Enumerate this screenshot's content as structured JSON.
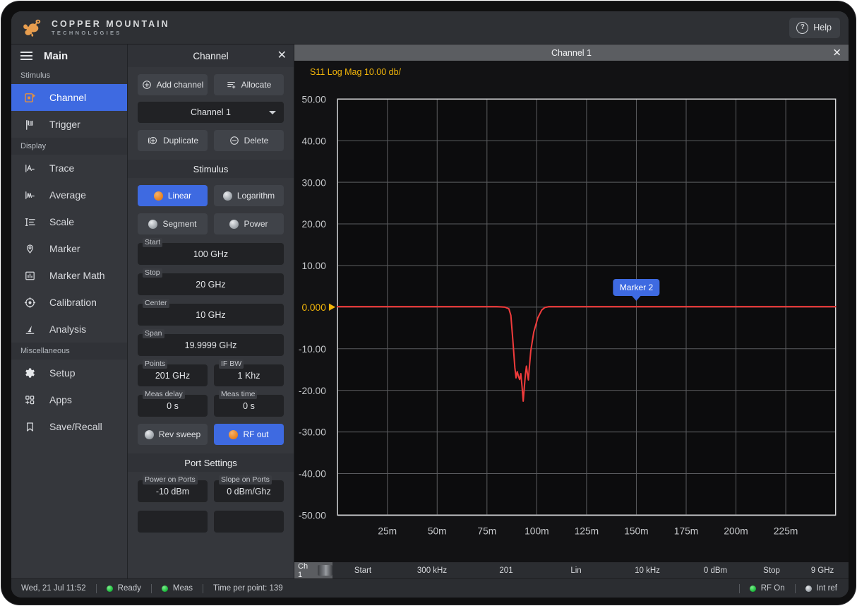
{
  "app": {
    "brand_line1": "COPPER MOUNTAIN",
    "brand_line2": "TECHNOLOGIES",
    "help_label": "Help",
    "help_icon": "question-circle-icon",
    "logo_icon": "lizard-logo-icon"
  },
  "sidebar": {
    "title": "Main",
    "menu_icon": "hamburger-icon",
    "groups": [
      {
        "label": "Stimulus",
        "items": [
          {
            "label": "Channel",
            "icon": "channel-icon",
            "active": true
          },
          {
            "label": "Trigger",
            "icon": "flag-icon",
            "active": false
          }
        ]
      },
      {
        "label": "Display",
        "items": [
          {
            "label": "Trace",
            "icon": "trace-icon",
            "active": false
          },
          {
            "label": "Average",
            "icon": "average-icon",
            "active": false
          },
          {
            "label": "Scale",
            "icon": "scale-icon",
            "active": false
          },
          {
            "label": "Marker",
            "icon": "map-pin-icon",
            "active": false
          },
          {
            "label": "Marker Math",
            "icon": "bar-chart-icon",
            "active": false
          },
          {
            "label": "Calibration",
            "icon": "target-icon",
            "active": false
          },
          {
            "label": "Analysis",
            "icon": "microscope-icon",
            "active": false
          }
        ]
      },
      {
        "label": "Miscellaneous",
        "items": [
          {
            "label": "Setup",
            "icon": "gear-icon",
            "active": false
          },
          {
            "label": "Apps",
            "icon": "apps-icon",
            "active": false
          },
          {
            "label": "Save/Recall",
            "icon": "bookmark-icon",
            "active": false
          }
        ]
      }
    ]
  },
  "channel_panel": {
    "title": "Channel",
    "close_icon": "close-icon",
    "add_channel": "Add channel",
    "add_channel_icon": "plus-circle-icon",
    "allocate": "Allocate",
    "allocate_icon": "allocate-icon",
    "selected_channel": "Channel 1",
    "duplicate": "Duplicate",
    "duplicate_icon": "duplicate-icon",
    "delete": "Delete",
    "delete_icon": "minus-circle-icon",
    "stimulus_title": "Stimulus",
    "sweep_types": [
      {
        "label": "Linear",
        "on": true
      },
      {
        "label": "Logarithm",
        "on": false
      },
      {
        "label": "Segment",
        "on": false
      },
      {
        "label": "Power",
        "on": false
      }
    ],
    "fields": [
      {
        "label": "Start",
        "value": "100 GHz"
      },
      {
        "label": "Stop",
        "value": "20 GHz"
      },
      {
        "label": "Center",
        "value": "10 GHz"
      },
      {
        "label": "Span",
        "value": "19.9999 GHz"
      }
    ],
    "field_pairs": [
      [
        {
          "label": "Points",
          "value": "201 GHz"
        },
        {
          "label": "IF BW",
          "value": "1 Khz"
        }
      ],
      [
        {
          "label": "Meas delay",
          "value": "0 s"
        },
        {
          "label": "Meas time",
          "value": "0 s"
        }
      ]
    ],
    "toggles": [
      {
        "label": "Rev sweep",
        "on": false
      },
      {
        "label": "RF out",
        "on": true
      }
    ],
    "port_settings_title": "Port Settings",
    "port_fields": [
      {
        "label": "Power on Ports",
        "value": "-10 dBm"
      },
      {
        "label": "Slope on Ports",
        "value": "0 dBm/Ghz"
      }
    ]
  },
  "chart_window": {
    "title": "Channel 1",
    "close_icon": "close-icon"
  },
  "chart_data": {
    "type": "line",
    "title": "S11 Log Mag 10.00 db/",
    "xlabel": "",
    "ylabel": "",
    "grid": true,
    "accent_color": "#f2b50a",
    "trace_color": "#ef3b3b",
    "reference_value": "0.000",
    "reference_marker_icon": "reference-triangle-icon",
    "ylim": [
      -50,
      50
    ],
    "ytick_labels": [
      "50.00",
      "40.00",
      "30.00",
      "20.00",
      "10.00",
      "0.000",
      "-10.00",
      "-20.00",
      "-30.00",
      "-40.00",
      "-50.00"
    ],
    "ytick_values": [
      50,
      40,
      30,
      20,
      10,
      0,
      -10,
      -20,
      -30,
      -40,
      -50
    ],
    "xtick_labels": [
      "25m",
      "50m",
      "75m",
      "100m",
      "125m",
      "150m",
      "175m",
      "200m",
      "225m"
    ],
    "xtick_values": [
      25,
      50,
      75,
      100,
      125,
      150,
      175,
      200,
      225
    ],
    "xlim": [
      0,
      250
    ],
    "markers": [
      {
        "label": "Marker 2",
        "x": 150,
        "y": 0
      }
    ],
    "series": [
      {
        "name": "S11",
        "points": [
          [
            0,
            0.1
          ],
          [
            10,
            0.1
          ],
          [
            20,
            0.1
          ],
          [
            30,
            0.1
          ],
          [
            40,
            0.1
          ],
          [
            50,
            0.1
          ],
          [
            60,
            0.1
          ],
          [
            70,
            0.1
          ],
          [
            80,
            0.1
          ],
          [
            84,
            0.0
          ],
          [
            86,
            -0.4
          ],
          [
            87,
            -2.0
          ],
          [
            88,
            -8.0
          ],
          [
            89,
            -14.5
          ],
          [
            89.6,
            -17.0
          ],
          [
            90.2,
            -15.5
          ],
          [
            90.8,
            -16.6
          ],
          [
            91.4,
            -17.4
          ],
          [
            92.0,
            -16.0
          ],
          [
            92.6,
            -19.0
          ],
          [
            93.2,
            -22.6
          ],
          [
            93.8,
            -19.0
          ],
          [
            94.3,
            -16.2
          ],
          [
            94.8,
            -14.2
          ],
          [
            95.3,
            -16.0
          ],
          [
            95.8,
            -17.5
          ],
          [
            96.2,
            -15.0
          ],
          [
            97.0,
            -10.5
          ],
          [
            98.5,
            -6.0
          ],
          [
            100.5,
            -2.6
          ],
          [
            102.5,
            -0.7
          ],
          [
            104,
            -0.1
          ],
          [
            106,
            0.1
          ],
          [
            115,
            0.1
          ],
          [
            130,
            0.1
          ],
          [
            150,
            0.1
          ],
          [
            175,
            0.1
          ],
          [
            200,
            0.1
          ],
          [
            225,
            0.1
          ],
          [
            250,
            0.1
          ]
        ]
      }
    ]
  },
  "channel_strip": {
    "channel_button": "Ch 1",
    "cells": [
      "Start",
      "300 kHz",
      "201",
      "Lin",
      "10 kHz",
      "0 dBm",
      "Stop",
      "9 GHz"
    ]
  },
  "status_bar": {
    "datetime": "Wed, 21 Jul 11:52",
    "ready": "Ready",
    "meas": "Meas",
    "time_per_point": "Time per point: 139",
    "rf_on": "RF On",
    "int_ref": "Int ref"
  }
}
